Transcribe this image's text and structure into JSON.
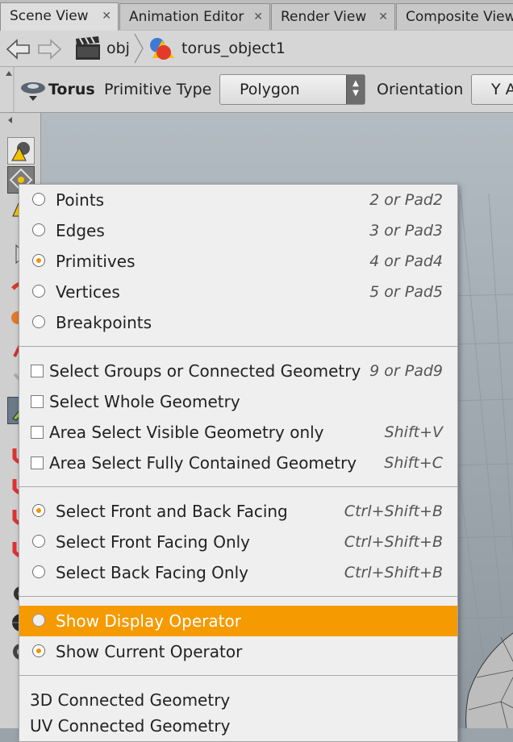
{
  "tabs": [
    {
      "label": "Scene View",
      "active": true
    },
    {
      "label": "Animation Editor",
      "active": false
    },
    {
      "label": "Render View",
      "active": false
    },
    {
      "label": "Composite View",
      "active": false
    }
  ],
  "pathbar": {
    "crumbs": [
      "obj",
      "torus_object1"
    ]
  },
  "toolbar": {
    "node_name": "Torus",
    "primitive_type_label": "Primitive Type",
    "primitive_type_value": "Polygon",
    "orientation_label": "Orientation",
    "orientation_value": "Y A"
  },
  "menu": {
    "component_modes": [
      {
        "label": "Points",
        "shortcut": "2 or Pad2",
        "selected": false
      },
      {
        "label": "Edges",
        "shortcut": "3 or Pad3",
        "selected": false
      },
      {
        "label": "Primitives",
        "shortcut": "4 or Pad4",
        "selected": true
      },
      {
        "label": "Vertices",
        "shortcut": "5 or Pad5",
        "selected": false
      },
      {
        "label": "Breakpoints",
        "shortcut": "",
        "selected": false
      }
    ],
    "options": [
      {
        "label": "Select Groups or Connected Geometry",
        "shortcut": "9 or Pad9",
        "checked": false
      },
      {
        "label": "Select Whole Geometry",
        "shortcut": "",
        "checked": false
      },
      {
        "label": "Area Select Visible Geometry only",
        "shortcut": "Shift+V",
        "checked": false
      },
      {
        "label": "Area Select Fully Contained Geometry",
        "shortcut": "Shift+C",
        "checked": false
      }
    ],
    "facing": [
      {
        "label": "Select Front and Back Facing",
        "shortcut": "Ctrl+Shift+B",
        "selected": true
      },
      {
        "label": "Select Front Facing Only",
        "shortcut": "Ctrl+Shift+B",
        "selected": false
      },
      {
        "label": "Select Back Facing Only",
        "shortcut": "Ctrl+Shift+B",
        "selected": false
      }
    ],
    "operator": [
      {
        "label": "Show Display Operator",
        "selected": false,
        "highlighted": true
      },
      {
        "label": "Show Current Operator",
        "selected": true,
        "highlighted": false
      }
    ],
    "connected": [
      {
        "label": "3D Connected Geometry"
      },
      {
        "label": "UV Connected Geometry"
      }
    ]
  },
  "colors": {
    "accent": "#f59a00",
    "menu_bg": "#efefef",
    "viewport_bg": "#a3acb3"
  }
}
